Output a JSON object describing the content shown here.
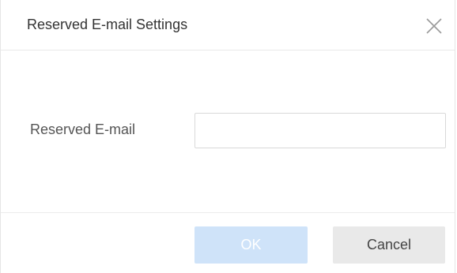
{
  "dialog": {
    "title": "Reserved E-mail Settings",
    "close_icon": "close-icon"
  },
  "form": {
    "email_label": "Reserved E-mail",
    "email_value": "",
    "email_placeholder": ""
  },
  "footer": {
    "ok_label": "OK",
    "ok_state": "disabled",
    "cancel_label": "Cancel"
  },
  "colors": {
    "ok_button_bg": "#cfe3f9",
    "cancel_button_bg": "#e9e9e9",
    "divider": "#e8e8e8"
  }
}
